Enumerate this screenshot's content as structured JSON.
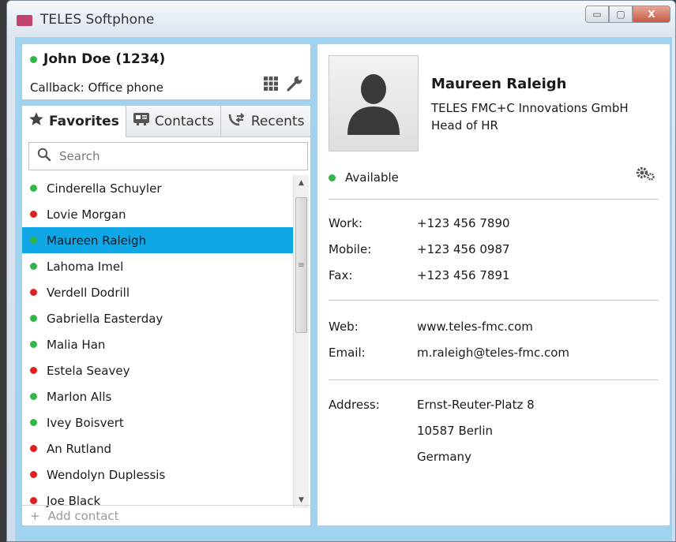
{
  "window": {
    "title": "TELES Softphone",
    "controls": {
      "minimize": "▭",
      "maximize": "▢",
      "close": "X"
    }
  },
  "user": {
    "name": "John Doe (1234)",
    "status_color": "#33b54a",
    "callback": "Callback: Office phone",
    "icons": [
      "dialpad-icon",
      "wrench-icon"
    ]
  },
  "tabs": [
    {
      "label": "Favorites",
      "icon": "star-icon",
      "active": true
    },
    {
      "label": "Contacts",
      "icon": "contacts-card-icon",
      "active": false
    },
    {
      "label": "Recents",
      "icon": "call-arrows-icon",
      "active": false
    }
  ],
  "search": {
    "placeholder": "Search"
  },
  "contacts": [
    {
      "name": "Cinderella Schuyler",
      "status": "green"
    },
    {
      "name": "Lovie Morgan",
      "status": "red"
    },
    {
      "name": "Maureen Raleigh",
      "status": "green",
      "selected": true
    },
    {
      "name": "Lahoma Imel",
      "status": "green"
    },
    {
      "name": "Verdell Dodrill",
      "status": "red"
    },
    {
      "name": "Gabriella Easterday",
      "status": "green"
    },
    {
      "name": "Malia Han",
      "status": "green"
    },
    {
      "name": "Estela Seavey",
      "status": "red"
    },
    {
      "name": "Marlon Alls",
      "status": "green"
    },
    {
      "name": "Ivey Boisvert",
      "status": "green"
    },
    {
      "name": "An Rutland",
      "status": "red"
    },
    {
      "name": "Wendolyn Duplessis",
      "status": "red"
    },
    {
      "name": "Joe Black",
      "status": "red"
    }
  ],
  "add_contact": {
    "icon": "+",
    "label": "Add contact"
  },
  "detail": {
    "name": "Maureen Raleigh",
    "company": "TELES FMC+C Innovations GmbH",
    "role": "Head of HR",
    "presence": "Available",
    "presence_color": "#33b54a",
    "phones": [
      {
        "label": "Work:",
        "value": "+123 456 7890"
      },
      {
        "label": "Mobile:",
        "value": "+123 456 0987"
      },
      {
        "label": "Fax:",
        "value": "+123 456 7891"
      }
    ],
    "web": {
      "label": "Web:",
      "value": "www.teles-fmc.com"
    },
    "email": {
      "label": "Email:",
      "value": "m.raleigh@teles-fmc.com"
    },
    "address": {
      "label": "Address:",
      "lines": [
        "Ernst-Reuter-Platz 8",
        "10587 Berlin",
        "Germany"
      ]
    }
  }
}
